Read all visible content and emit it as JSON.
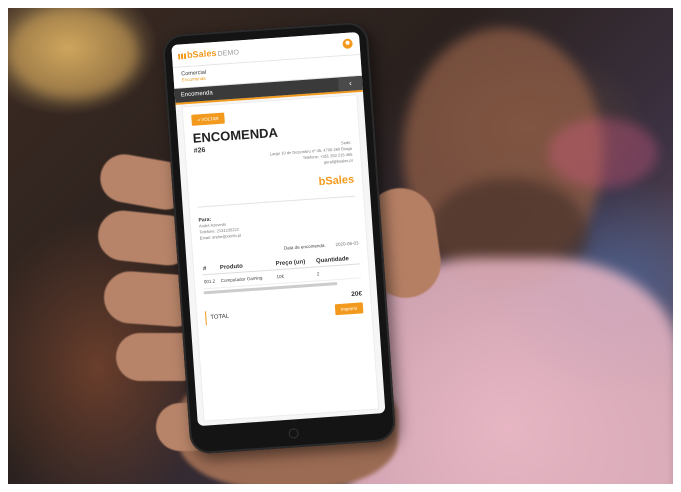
{
  "app": {
    "logo_text": "bSales",
    "logo_suffix": "DEMO"
  },
  "menu": {
    "item_title": "Comercial",
    "item_subtitle": "Encomenda"
  },
  "breadcrumb": {
    "label": "Encomenda",
    "back_icon": "chevron-left-icon"
  },
  "document": {
    "back_button": "« VOLTAR",
    "title": "ENCOMENDA",
    "number": "#26",
    "company_lines": [
      "Sede:",
      "Largo 10 de Dezembro nº 45, 4700-260 Braga",
      "Telefone: +351 253 215 465",
      "geral@bsales.pt"
    ],
    "brand_logo": "bSales",
    "to_label": "Para:",
    "to_lines": [
      "André Azevedo",
      "Telefone: 2131235222",
      "Email: andre@xxinfo.pt"
    ],
    "date_label": "Data de encomenda:",
    "date_value": "2020-06-03",
    "table": {
      "headers": [
        "#",
        "Produto",
        "Preço (un)",
        "Quantidade"
      ],
      "rows": [
        [
          "001.2",
          "Computador Gaming",
          "10€",
          "2"
        ]
      ]
    },
    "total_value": "20€",
    "total_label": "TOTAL",
    "print_button": "Imprimir"
  },
  "colors": {
    "accent": "#f29a1d",
    "header_dark": "#3a3a3a"
  }
}
